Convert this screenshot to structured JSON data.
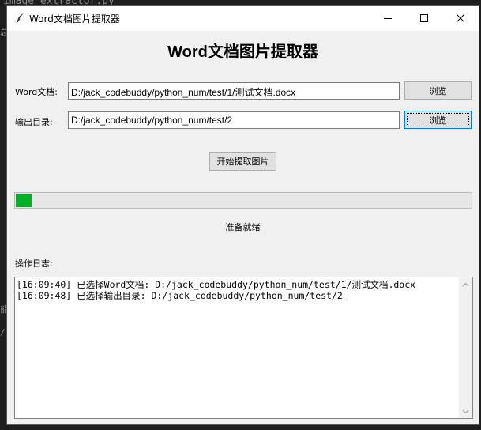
{
  "background": {
    "tab_text": "image extractor.py",
    "fragments": [
      "总",
      "能",
      "/"
    ]
  },
  "window": {
    "title": "Word文档图片提取器",
    "controls": {
      "minimize": "minimize-icon",
      "maximize": "maximize-icon",
      "close": "close-icon"
    }
  },
  "app": {
    "heading": "Word文档图片提取器"
  },
  "word_file": {
    "label": "Word文档:",
    "value": "D:/jack_codebuddy/python_num/test/1/测试文档.docx",
    "browse_label": "浏览"
  },
  "output_dir": {
    "label": "输出目录:",
    "value": "D:/jack_codebuddy/python_num/test/2",
    "browse_label": "浏览"
  },
  "extract_button": "开始提取图片",
  "progress": {
    "percent": 2,
    "color": "#06b025"
  },
  "status": "准备就绪",
  "log": {
    "label": "操作日志:",
    "lines": [
      "[16:09:40] 已选择Word文档: D:/jack_codebuddy/python_num/test/1/测试文档.docx",
      "[16:09:48] 已选择输出目录: D:/jack_codebuddy/python_num/test/2"
    ]
  }
}
